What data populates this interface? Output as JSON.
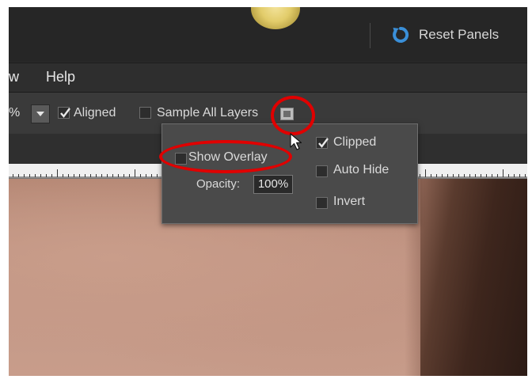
{
  "header": {
    "reset_panels_label": "Reset Panels",
    "reset_icon": "reset-icon"
  },
  "menu": {
    "items": [
      {
        "label": "w"
      },
      {
        "label": "Help"
      }
    ]
  },
  "options_bar": {
    "percent_text": "%",
    "aligned_label": "Aligned",
    "aligned_checked": true,
    "sample_all_layers_label": "Sample All Layers",
    "sample_all_layers_checked": false,
    "overlay_icon": "clone-overlay-icon"
  },
  "overlay_popup": {
    "show_overlay_label": "Show Overlay",
    "show_overlay_checked": false,
    "opacity_label": "Opacity:",
    "opacity_value": "100%",
    "clipped_label": "Clipped",
    "clipped_checked": true,
    "auto_hide_label": "Auto Hide",
    "auto_hide_checked": false,
    "invert_label": "Invert",
    "invert_checked": false
  },
  "colors": {
    "highlight": "#e00000",
    "reset_icon": "#3a8fd8"
  }
}
